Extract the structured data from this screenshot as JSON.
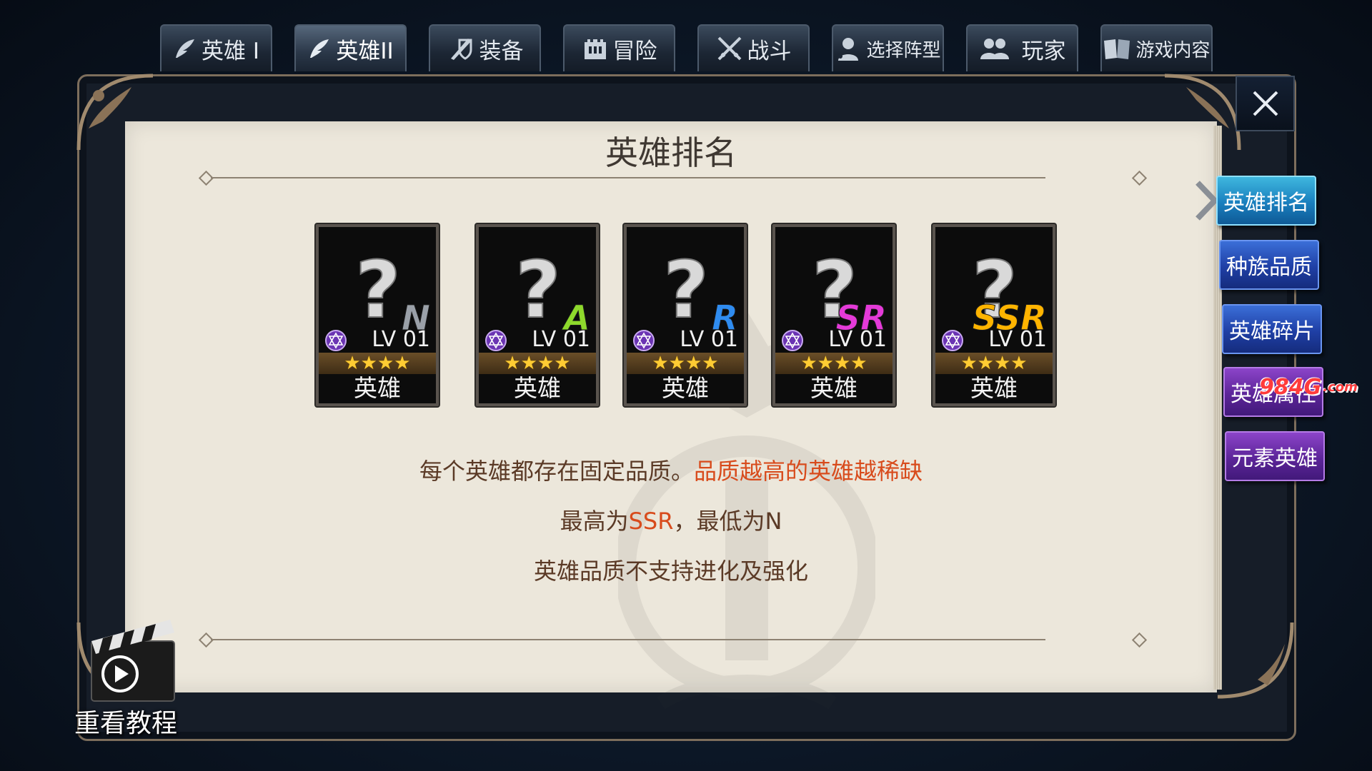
{
  "tabs": [
    {
      "label": "英雄 I",
      "icon": "feather-icon",
      "active": false
    },
    {
      "label": "英雄II",
      "icon": "feather-icon",
      "active": true
    },
    {
      "label": "装备",
      "icon": "sword-shield-icon",
      "active": false
    },
    {
      "label": "冒险",
      "icon": "castle-icon",
      "active": false
    },
    {
      "label": "战斗",
      "icon": "crossed-swords-icon",
      "active": false
    },
    {
      "label": "选择阵型",
      "icon": "formation-icon",
      "active": false
    },
    {
      "label": "玩家",
      "icon": "players-icon",
      "active": false
    },
    {
      "label": "游戏内容",
      "icon": "book-icon",
      "active": false
    }
  ],
  "panel": {
    "title": "英雄排名",
    "cards": [
      {
        "grade": "N",
        "grade_color": "#9aa0a8",
        "level": "LV 01",
        "stars": "★★★★",
        "name": "英雄"
      },
      {
        "grade": "A",
        "grade_color": "#8ed92c",
        "level": "LV 01",
        "stars": "★★★★",
        "name": "英雄"
      },
      {
        "grade": "R",
        "grade_color": "#2f8cf0",
        "level": "LV 01",
        "stars": "★★★★",
        "name": "英雄"
      },
      {
        "grade": "SR",
        "grade_color": "#e43ad8",
        "level": "LV 01",
        "stars": "★★★★",
        "name": "英雄"
      },
      {
        "grade": "SSR",
        "grade_color": "#ffb400",
        "level": "LV 01",
        "stars": "★★★★",
        "name": "英雄"
      }
    ],
    "line1_a": "每个英雄都存在固定品质。",
    "line1_b": "品质越高的英雄越稀缺",
    "line2_a": "最高为",
    "line2_b": "SSR",
    "line2_c": "，最低为N",
    "line3": "英雄品质不支持进化及强化"
  },
  "side_menu": [
    {
      "label": "英雄排名",
      "style": "active"
    },
    {
      "label": "种族品质",
      "style": "blue"
    },
    {
      "label": "英雄碎片",
      "style": "blue"
    },
    {
      "label": "英雄属性",
      "style": "purple"
    },
    {
      "label": "元素英雄",
      "style": "purple"
    }
  ],
  "tutorial": {
    "label": "重看教程"
  },
  "watermark": {
    "text": "984G",
    "suffix": ".com"
  },
  "colors": {
    "highlight": "#d84b1c",
    "body_text": "#5b3a26"
  }
}
